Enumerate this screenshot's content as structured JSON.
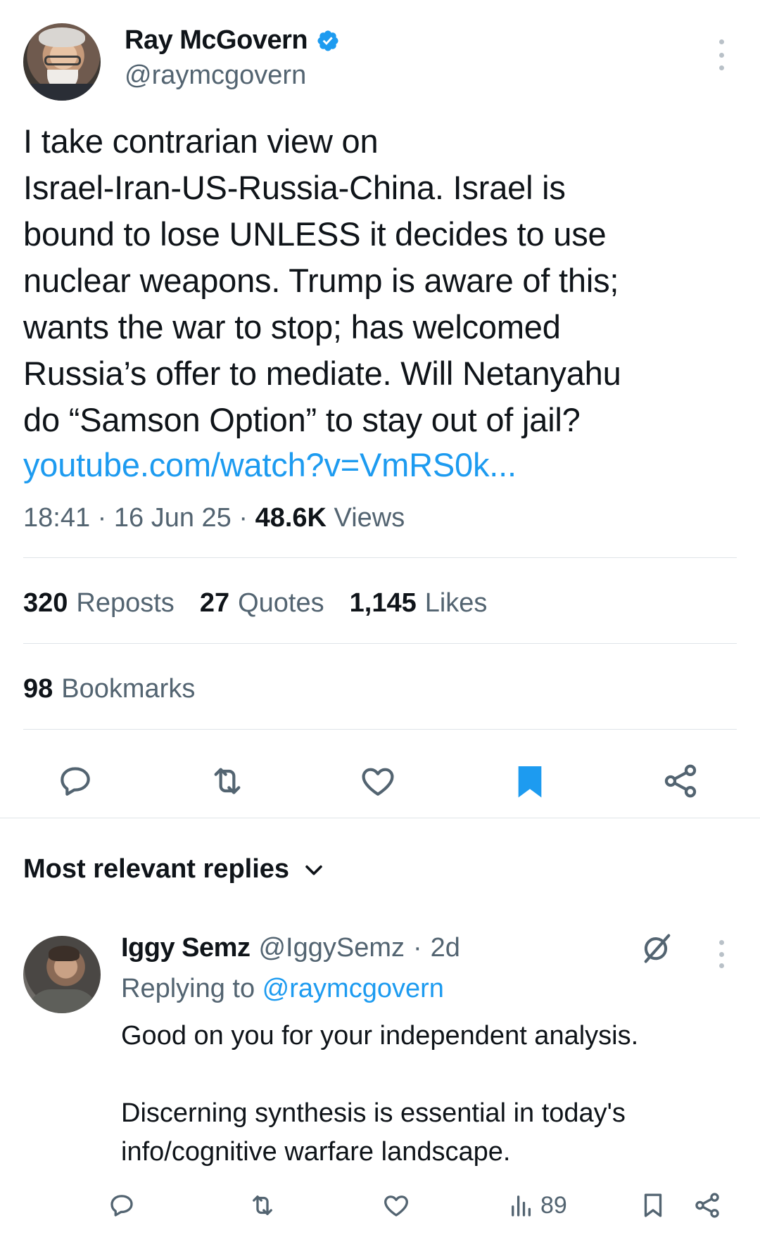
{
  "tweet": {
    "author_name": "Ray McGovern",
    "author_handle": "@raymcgovern",
    "text": "I take contrarian view on\nIsrael-Iran-US-Russia-China. Israel is\nbound to lose UNLESS it decides to use\nnuclear weapons. Trump is aware of this;\nwants the war to stop; has welcomed\nRussia’s offer to mediate. Will Netanyahu\ndo “Samson Option” to stay out of jail?",
    "link": "youtube.com/watch?v=VmRS0k...",
    "time": "18:41",
    "sep1": " · ",
    "date": "16 Jun 25",
    "sep2": " · ",
    "views_count": "48.6K",
    "views_label": " Views"
  },
  "stats": {
    "reposts_count": "320",
    "reposts_label": "Reposts",
    "quotes_count": "27",
    "quotes_label": "Quotes",
    "likes_count": "1,145",
    "likes_label": "Likes",
    "bookmarks_count": "98",
    "bookmarks_label": "Bookmarks"
  },
  "actions": {
    "icons": [
      "reply-icon",
      "repost-icon",
      "like-icon",
      "bookmark-filled-icon",
      "share-icon"
    ],
    "bookmark_color": "#1d9bf0"
  },
  "replies": {
    "sort_label": "Most relevant replies",
    "items": [
      {
        "name": "Iggy Semz",
        "handle": "@IggySemz",
        "dot": "·",
        "time": "2d",
        "replying_prefix": "Replying to ",
        "replying_to": "@raymcgovern",
        "paragraphs": [
          "Good on you for your independent analysis.",
          "Discerning synthesis is essential in today's info/cognitive warfare landscape."
        ],
        "views": "89"
      }
    ]
  },
  "colors": {
    "accent": "#1d9bf0",
    "text_primary": "#0f1419",
    "text_secondary": "#536471",
    "divider": "#dfe4e8"
  }
}
